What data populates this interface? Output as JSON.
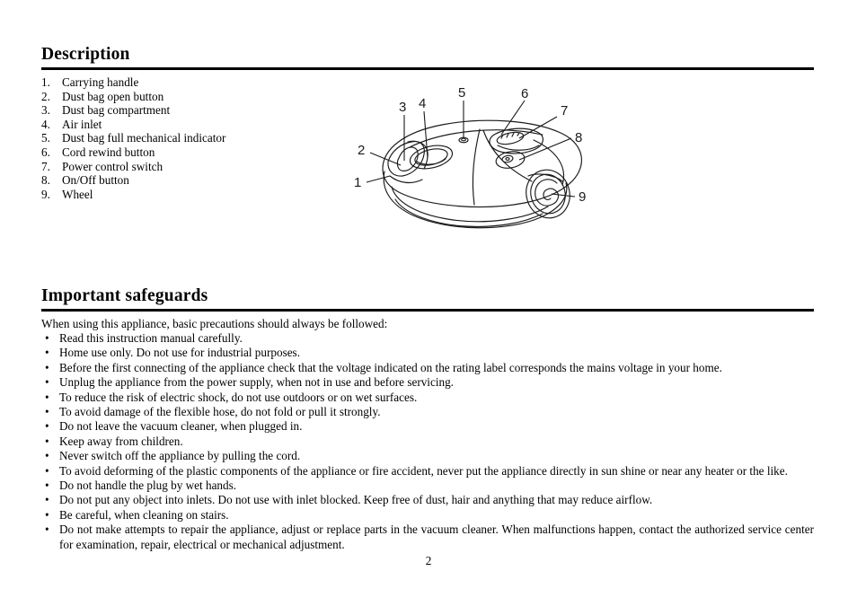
{
  "document": {
    "page_number": "2"
  },
  "sections": {
    "description": {
      "heading": "Description",
      "items": [
        {
          "num": "1.",
          "label": "Carrying handle"
        },
        {
          "num": "2.",
          "label": "Dust bag open button"
        },
        {
          "num": "3.",
          "label": "Dust bag compartment"
        },
        {
          "num": "4.",
          "label": "Air inlet"
        },
        {
          "num": "5.",
          "label": "Dust bag full mechanical indicator"
        },
        {
          "num": "6.",
          "label": "Cord rewind button"
        },
        {
          "num": "7.",
          "label": "Power control switch"
        },
        {
          "num": "8.",
          "label": "On/Off button"
        },
        {
          "num": "9.",
          "label": "Wheel"
        }
      ]
    },
    "safeguards": {
      "heading": "Important safeguards",
      "intro": "When using this appliance, basic precautions should always be followed:",
      "bullet_char": "•",
      "items": [
        "Read this instruction manual carefully.",
        "Home use only. Do not use for industrial purposes.",
        "Before the first connecting of the appliance check that the voltage indicated on the rating label corresponds the mains voltage in your home.",
        "Unplug the appliance from the power supply, when not in use and before servicing.",
        "To reduce the risk of electric shock, do not use outdoors or on wet surfaces.",
        "To avoid damage of the flexible hose, do not fold or pull it strongly.",
        "Do not leave the vacuum cleaner, when plugged in.",
        "Keep away from children.",
        "Never switch off the appliance by pulling the cord.",
        "To avoid deforming of the plastic components of the appliance or fire accident, never put the appliance directly in sun shine or near any heater or the like.",
        "Do not handle the plug by wet hands.",
        "Do not put any object into inlets. Do not use with inlet blocked. Keep free of dust, hair and anything that may reduce airflow.",
        "Be careful, when cleaning on stairs.",
        "Do not make attempts to repair the appliance, adjust or replace parts in the vacuum cleaner. When malfunctions happen, contact the authorized service center for examination, repair, electrical or mechanical adjustment."
      ]
    }
  },
  "figure": {
    "title": "vacuum-cleaner-line-drawing",
    "callouts": [
      {
        "id": "1",
        "label": "1",
        "part": "Carrying handle"
      },
      {
        "id": "2",
        "label": "2",
        "part": "Dust bag open button"
      },
      {
        "id": "3",
        "label": "3",
        "part": "Dust bag compartment"
      },
      {
        "id": "4",
        "label": "4",
        "part": "Air inlet"
      },
      {
        "id": "5",
        "label": "5",
        "part": "Dust bag full mechanical indicator"
      },
      {
        "id": "6",
        "label": "6",
        "part": "Cord rewind button"
      },
      {
        "id": "7",
        "label": "7",
        "part": "Power control switch"
      },
      {
        "id": "8",
        "label": "8",
        "part": "On/Off button"
      },
      {
        "id": "9",
        "label": "9",
        "part": "Wheel"
      }
    ]
  },
  "colors": {
    "text": "#000000",
    "rule": "#000000",
    "line_art": "#1a1a1a",
    "background": "#ffffff"
  }
}
